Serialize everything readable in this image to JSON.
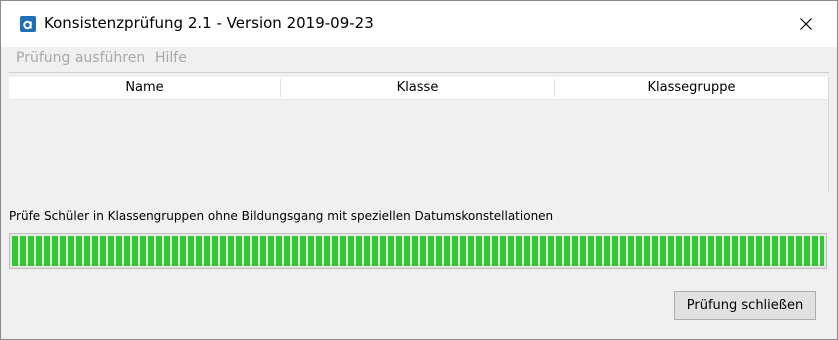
{
  "window": {
    "title": "Konsistenzprüfung 2.1 - Version 2019-09-23"
  },
  "menu": {
    "items": [
      {
        "label": "Prüfung ausführen"
      },
      {
        "label": "Hilfe"
      }
    ]
  },
  "table": {
    "columns": [
      "Name",
      "Klasse",
      "Klassegruppe"
    ],
    "rows": []
  },
  "status": {
    "text": "Prüfe Schüler in Klassengruppen ohne Bildungsgang mit speziellen Datumskonstellationen"
  },
  "progress": {
    "fraction": 1.0,
    "color": "#32c832"
  },
  "buttons": {
    "close_label": "Prüfung schließen"
  }
}
